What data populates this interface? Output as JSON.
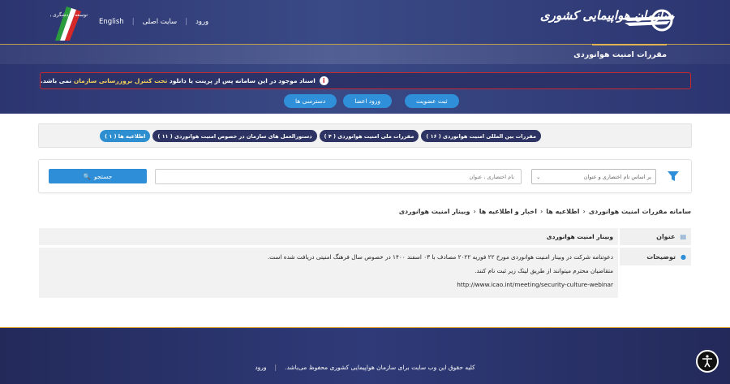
{
  "header": {
    "logo_text": "سازمان هواپیمایی کشوری",
    "page_heading": "مقررات امنیت هوانوردی",
    "emblem_text": "توسعه گردشگری و دانش بنیان"
  },
  "top_nav": {
    "login": "ورود",
    "main_site": "سایت اصلی",
    "english": "English"
  },
  "alert": {
    "text_start": "اسناد موجود در این سامانه پس از پرینت یا دانلود",
    "text_highlight": "تحت کنترل بروزرسانی سازمان",
    "text_end": "نمی باشد.",
    "icon": "info-icon"
  },
  "auth_buttons": {
    "register": "ثبت عضویت",
    "member_login": "ورود اعضا",
    "access": "دسترسی ها"
  },
  "categories": [
    {
      "label": "مقررات بین المللی امنیت هوانوردی ( ۱۶ )",
      "active": false
    },
    {
      "label": "مقررات ملی امنیت هوانوردی ( ۴ )",
      "active": false
    },
    {
      "label": "دستورالعمل های سازمان در خصوص امنیت هوانوردی ( ۱۱ )",
      "active": false
    },
    {
      "label": "اطلاعیه ها ( ۱ )",
      "active": true
    }
  ],
  "search": {
    "select_value": "بر اساس نام اختصاری و عنوان",
    "input_placeholder": "نام اختصاری ، عنوان",
    "button_label": "جستجو"
  },
  "breadcrumb": [
    "سامانه مقررات امنیت هوانوردی",
    "اطلاعیه ها",
    "اخبار و اطلاعیه ها",
    "وبینار امنیت هوانوردی"
  ],
  "detail": {
    "title_label": "عنوان",
    "title_value": "وبینار امنیت هوانوردی",
    "desc_label": "توضیحات",
    "desc_lines": [
      "دعوتنامه شرکت در وبینار امنیت هوانوردی مورخ ۲۲ فوریه ۲۰۲۲ مصادف با ۰۳ اسفند ۱۴۰۰ در خصوص سال فرهنگ امنیتی دریافت شده است.",
      "متقاضیان محترم میتوانند از طریق لینک زیر ثبت نام کنند.",
      "http://www.icao.int/meeting/security-culture-webinar"
    ]
  },
  "footer": {
    "copyright": "کلیه حقوق این وب سایت برای سازمان هواپیمایی کشوری محفوظ می‌باشد.",
    "login": "ورود"
  },
  "colors": {
    "header_bg": "#2c3570",
    "accent_blue": "#2e8fd8",
    "pill_dark": "#2d3363",
    "alert_border": "#c8282e",
    "gold": "#e0b54f"
  }
}
